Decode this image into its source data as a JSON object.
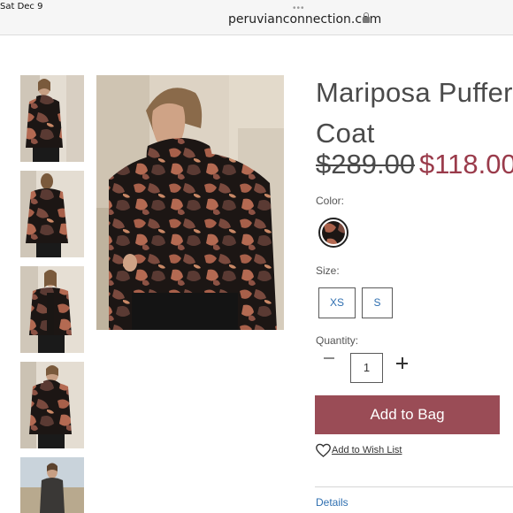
{
  "status_bar": {
    "time": "Sat Dec 9"
  },
  "browser": {
    "url": "peruvianconnection.com"
  },
  "product": {
    "title": "Mariposa Puffer Coat",
    "old_price": "$289.00",
    "new_price": "$118.00",
    "color_label": "Color:",
    "size_label": "Size:",
    "sizes": [
      "XS",
      "S"
    ],
    "quantity_label": "Quantity:",
    "quantity": "1",
    "add_to_bag": "Add to Bag",
    "wish_list": "Add to Wish List",
    "details": "Details"
  },
  "colors": {
    "accent": "#9a4c56",
    "sale_price": "#9a3b4b",
    "link": "#2f6fb0"
  }
}
